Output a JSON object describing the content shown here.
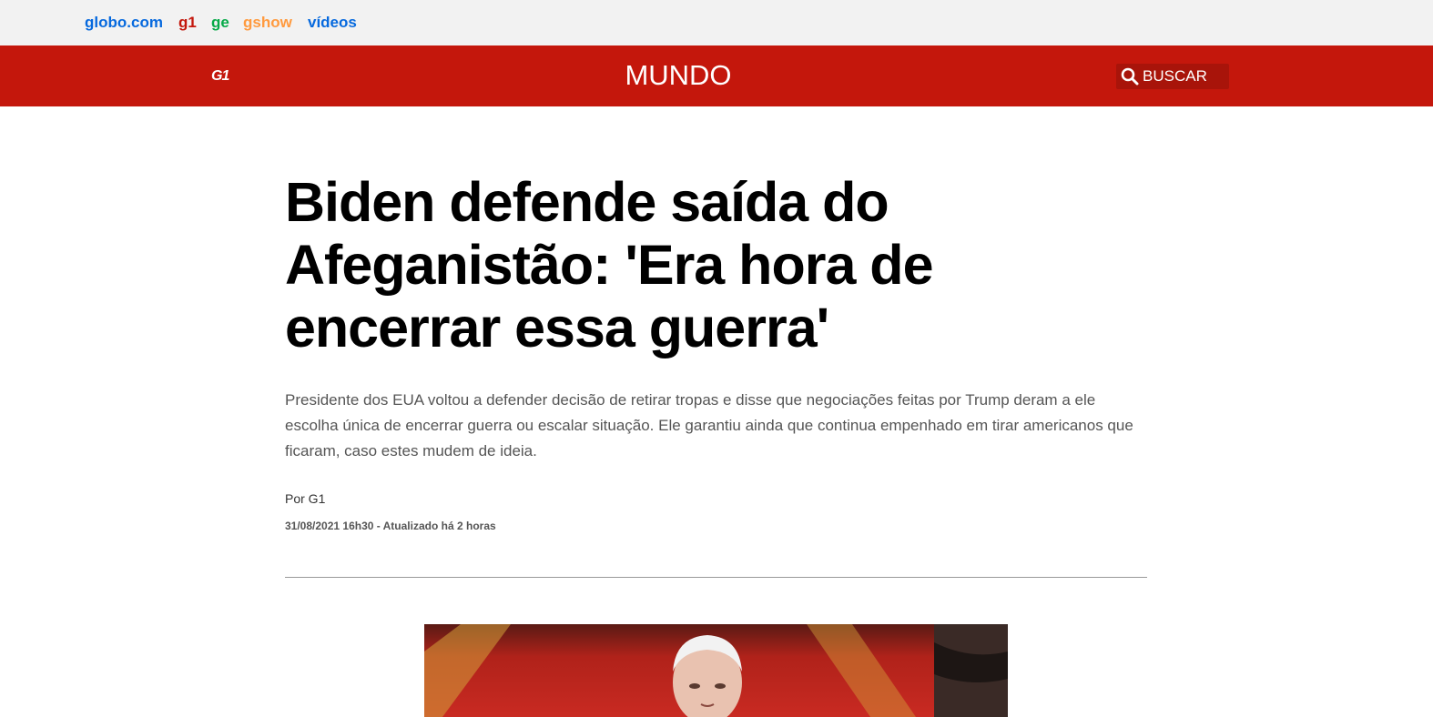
{
  "globo_bar": {
    "links": [
      {
        "label": "globo.com",
        "color": "#0669de"
      },
      {
        "label": "g1",
        "color": "#c4170c"
      },
      {
        "label": "ge",
        "color": "#06aa48"
      },
      {
        "label": "gshow",
        "color": "#ff9a3e"
      },
      {
        "label": "vídeos",
        "color": "#0669de"
      }
    ]
  },
  "header": {
    "logo": "G1",
    "section": "MUNDO",
    "search_label": "BUSCAR",
    "accent_color": "#c4170c"
  },
  "article": {
    "headline": "Biden defende saída do Afeganistão: 'Era hora de encerrar essa guerra'",
    "subtitle": "Presidente dos EUA voltou a defender decisão de retirar tropas e disse que negociações feitas por Trump deram a ele escolha única de encerrar guerra ou escalar situação. Ele garantiu ainda que continua empenhado em tirar americanos que ficaram, caso estes mudem de ideia.",
    "author": "Por G1",
    "dateline": "31/08/2021 16h30 - Atualizado há 2 horas"
  },
  "icons": {
    "search": "search-icon"
  }
}
